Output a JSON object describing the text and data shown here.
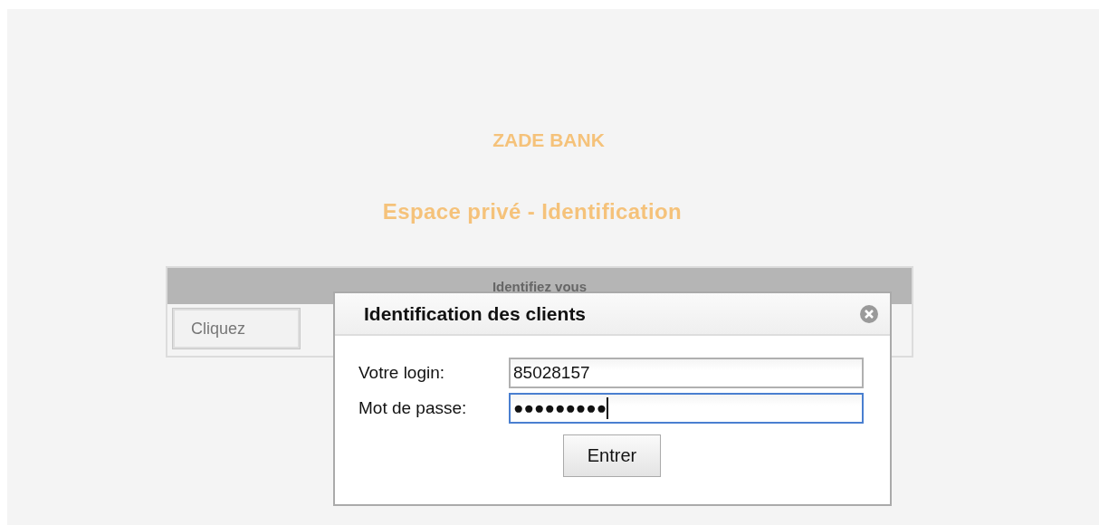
{
  "bank_name": "ZADE BANK",
  "page_title": "Espace privé - Identification",
  "panel": {
    "header": "Identifiez vous",
    "button": "Cliquez"
  },
  "dialog": {
    "title": "Identification des clients",
    "fields": [
      {
        "label": "Votre login:",
        "value": "85028157",
        "focused": false
      },
      {
        "label": "Mot de passe:",
        "value": "●●●●●●●●●",
        "focused": true
      }
    ],
    "submit": "Entrer"
  }
}
